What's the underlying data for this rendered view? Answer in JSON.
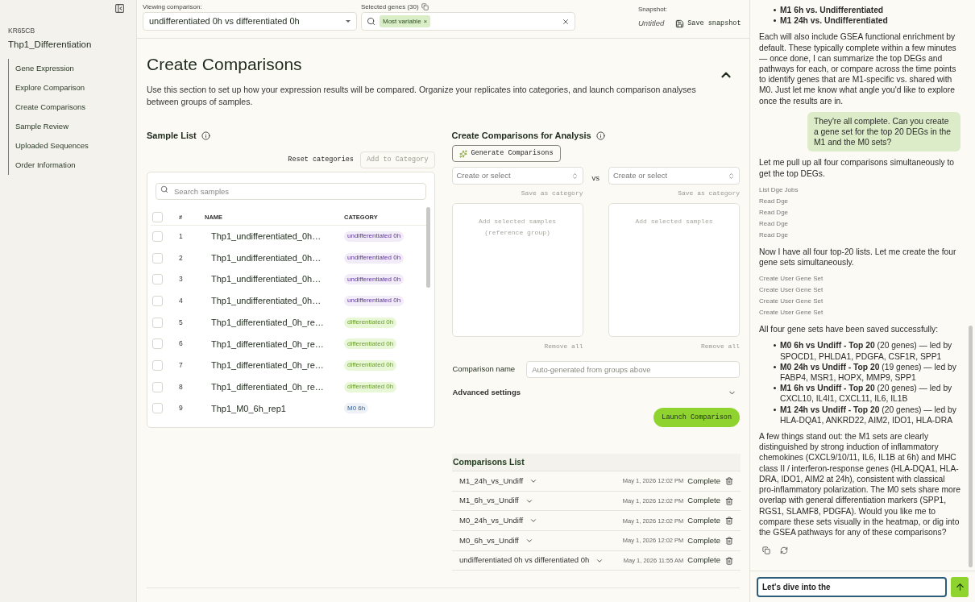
{
  "sidebar": {
    "project_code": "KR65CB",
    "project_name": "Thp1_Differentiation",
    "items": [
      {
        "label": "Gene Expression",
        "selected": false
      },
      {
        "label": "Explore Comparison",
        "selected": false
      },
      {
        "label": "Create Comparisons",
        "selected": false
      },
      {
        "label": "Sample Review",
        "selected": false
      },
      {
        "label": "Uploaded Sequences",
        "selected": false
      },
      {
        "label": "Order Information",
        "selected": false
      }
    ]
  },
  "topbar": {
    "viewing_label": "Viewing comparison:",
    "viewing_value": "undifferentiated 0h vs differentiated 0h",
    "genes_label": "Selected genes (30)",
    "gene_chip": "Most variable",
    "chip_remove": "×",
    "snapshot_label": "Snapshot:",
    "snapshot_name": "Untitled",
    "save_snapshot": "Save snapshot"
  },
  "section": {
    "title": "Create Comparisons",
    "description": "Use this section to set up how your expression results will be compared. Organize your replicates into categories, and launch comparison analyses between groups of samples.",
    "expanded": true
  },
  "sample_list": {
    "title": "Sample List",
    "reset": "Reset categories",
    "add_to_category": {
      "label": "Add to Category",
      "disabled": true
    },
    "search_placeholder": "Search samples",
    "select_all": {
      "checked": false
    },
    "columns": [
      "#",
      "NAME",
      "CATEGORY"
    ],
    "rows": [
      {
        "index": "1",
        "name": "Thp1_undifferentiated_0h…",
        "category": "undifferentiated 0h",
        "color": "#f1ecf8",
        "checked": false
      },
      {
        "index": "2",
        "name": "Thp1_undifferentiated_0h…",
        "category": "undifferentiated 0h",
        "color": "#f1ecf8",
        "checked": false
      },
      {
        "index": "3",
        "name": "Thp1_undifferentiated_0h…",
        "category": "undifferentiated 0h",
        "color": "#f1ecf8",
        "checked": false
      },
      {
        "index": "4",
        "name": "Thp1_undifferentiated_0h…",
        "category": "undifferentiated 0h",
        "color": "#f1ecf8",
        "checked": false
      },
      {
        "index": "5",
        "name": "Thp1_differentiated_0h_re…",
        "category": "differentiated 0h",
        "color": "#e8f7d6",
        "checked": false
      },
      {
        "index": "6",
        "name": "Thp1_differentiated_0h_re…",
        "category": "differentiated 0h",
        "color": "#e8f7d6",
        "checked": false
      },
      {
        "index": "7",
        "name": "Thp1_differentiated_0h_re…",
        "category": "differentiated 0h",
        "color": "#e8f7d6",
        "checked": false
      },
      {
        "index": "8",
        "name": "Thp1_differentiated_0h_re…",
        "category": "differentiated 0h",
        "color": "#e8f7d6",
        "checked": false
      },
      {
        "index": "9",
        "name": "Thp1_M0_6h_rep1",
        "category": "M0 6h",
        "color": "#eef1f5",
        "checked": false
      }
    ]
  },
  "analysis": {
    "title": "Create Comparisons for Analysis",
    "generate": "Generate Comparisons",
    "vs": "vs",
    "groups": [
      {
        "select_placeholder": "Create or select",
        "save": "Save as category",
        "drop_hint": "Add selected samples (reference group)",
        "remove": "Remove all"
      },
      {
        "select_placeholder": "Create or select",
        "save": "Save as category",
        "drop_hint": "Add selected samples",
        "remove": "Remove all"
      }
    ],
    "name_label": "Comparison name",
    "name_placeholder": "Auto-generated from groups above",
    "advanced": {
      "label": "Advanced settings",
      "expanded": false
    },
    "launch": "Launch Comparison"
  },
  "comparisons": {
    "title": "Comparisons List",
    "rows": [
      {
        "name": "M1_24h_vs_Undiff",
        "date": "May 1, 2026 12:02 PM",
        "status": "Complete"
      },
      {
        "name": "M1_6h_vs_Undiff",
        "date": "May 1, 2026 12:02 PM",
        "status": "Complete"
      },
      {
        "name": "M0_24h_vs_Undiff",
        "date": "May 1, 2026 12:02 PM",
        "status": "Complete"
      },
      {
        "name": "M0_6h_vs_Undiff",
        "date": "May 1, 2026 12:02 PM",
        "status": "Complete"
      },
      {
        "name": "undifferentiated 0h vs differentiated 0h",
        "date": "May 1, 2026 11:55 AM",
        "status": "Complete"
      }
    ]
  },
  "chat": {
    "messages": [
      {
        "kind": "bold_bullets",
        "items": [
          "M1 6h vs. Undifferentiated",
          "M1 24h vs. Undifferentiated"
        ]
      },
      {
        "kind": "text",
        "text": "Each will also include GSEA functional enrichment by default. These typically complete within a few minutes — once done, I can summarize the top DEGs and pathways for each, or compare across the time points to identify genes that are M1-specific vs. shared with M0. Just let me know what angle you'd like to explore once the results are in."
      },
      {
        "kind": "user",
        "text": "They're all complete. Can you create a gene set for the top 20 DEGs in the M1 and the M0 sets?"
      },
      {
        "kind": "text",
        "text": "Let me pull up all four comparisons simultaneously to get the top DEGs."
      },
      {
        "kind": "tools",
        "items": [
          "List Dge Jobs",
          "Read Dge",
          "Read Dge",
          "Read Dge",
          "Read Dge"
        ]
      },
      {
        "kind": "text",
        "text": "Now I have all four top-20 lists. Let me create the four gene sets simultaneously."
      },
      {
        "kind": "tools",
        "items": [
          "Create User Gene Set",
          "Create User Gene Set",
          "Create User Gene Set",
          "Create User Gene Set"
        ]
      },
      {
        "kind": "text",
        "text": "All four gene sets have been saved successfully:"
      },
      {
        "kind": "bullets",
        "items": [
          "**M0 6h vs Undiff - Top 20** (20 genes) — led by SPOCD1, PHLDA1, PDGFA, CSF1R, SPP1",
          "**M0 24h vs Undiff - Top 20** (19 genes) — led by FABP4, MSR1, HOPX, MMP9, SPP1",
          "**M1 6h vs Undiff - Top 20** (20 genes) — led by CXCL10, IL4I1, CXCL11, IL6, IL1B",
          "**M1 24h vs Undiff - Top 20** (20 genes) — led by HLA-DQA1, ANKRD22, AIM2, IDO1, HLA-DRA"
        ]
      },
      {
        "kind": "text",
        "text": "A few things stand out: the M1 sets are clearly distinguished by strong induction of inflammatory chemokines (CXCL9/10/11, IL6, IL1B at 6h) and MHC class II / interferon-response genes (HLA-DQA1, HLA-DRA, IDO1, AIM2 at 24h), consistent with classical pro-inflammatory polarization. The M0 sets share more overlap with general differentiation markers (SPP1, RGS1, SLAMF8, PDGFA). Would you like me to compare these sets visually in the heatmap, or dig into the GSEA pathways for any of these comparisons?"
      },
      {
        "kind": "actions"
      }
    ],
    "input_value": "Let's dive into the"
  }
}
